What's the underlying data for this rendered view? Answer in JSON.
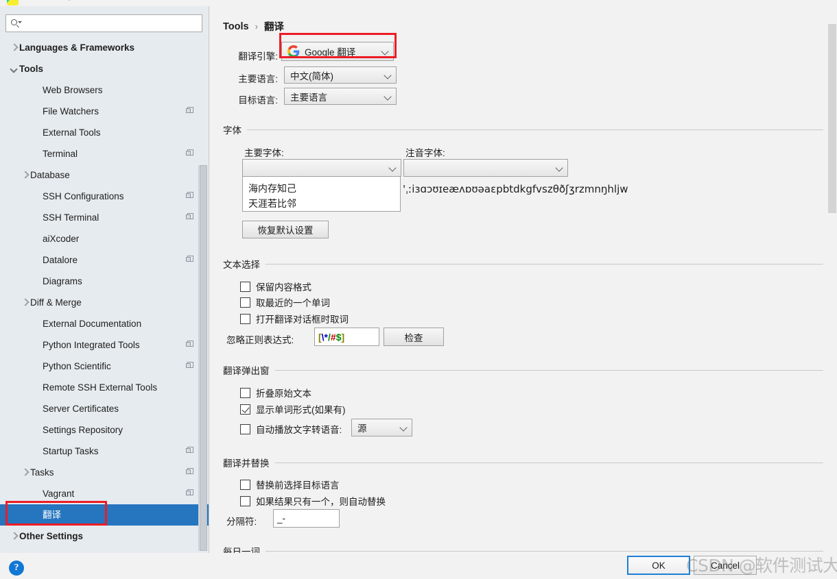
{
  "window": {
    "titlebar_icon": "pycharm-logo-icon"
  },
  "sidebar": {
    "search": {
      "value": "",
      "placeholder": ""
    },
    "items": [
      {
        "label": "Languages & Frameworks",
        "indent": 0,
        "arrow": "right",
        "bold": true,
        "copy": false,
        "selected": false
      },
      {
        "label": "Tools",
        "indent": 0,
        "arrow": "down",
        "bold": true,
        "copy": false,
        "selected": false
      },
      {
        "label": "Web Browsers",
        "indent": 2,
        "arrow": "none",
        "bold": false,
        "copy": false,
        "selected": false
      },
      {
        "label": "File Watchers",
        "indent": 2,
        "arrow": "none",
        "bold": false,
        "copy": true,
        "selected": false
      },
      {
        "label": "External Tools",
        "indent": 2,
        "arrow": "none",
        "bold": false,
        "copy": false,
        "selected": false
      },
      {
        "label": "Terminal",
        "indent": 2,
        "arrow": "none",
        "bold": false,
        "copy": true,
        "selected": false
      },
      {
        "label": "Database",
        "indent": 1,
        "arrow": "right",
        "bold": false,
        "copy": false,
        "selected": false
      },
      {
        "label": "SSH Configurations",
        "indent": 2,
        "arrow": "none",
        "bold": false,
        "copy": true,
        "selected": false
      },
      {
        "label": "SSH Terminal",
        "indent": 2,
        "arrow": "none",
        "bold": false,
        "copy": true,
        "selected": false
      },
      {
        "label": "aiXcoder",
        "indent": 2,
        "arrow": "none",
        "bold": false,
        "copy": false,
        "selected": false
      },
      {
        "label": "Datalore",
        "indent": 2,
        "arrow": "none",
        "bold": false,
        "copy": true,
        "selected": false
      },
      {
        "label": "Diagrams",
        "indent": 2,
        "arrow": "none",
        "bold": false,
        "copy": false,
        "selected": false
      },
      {
        "label": "Diff & Merge",
        "indent": 1,
        "arrow": "right",
        "bold": false,
        "copy": false,
        "selected": false
      },
      {
        "label": "External Documentation",
        "indent": 2,
        "arrow": "none",
        "bold": false,
        "copy": false,
        "selected": false
      },
      {
        "label": "Python Integrated Tools",
        "indent": 2,
        "arrow": "none",
        "bold": false,
        "copy": true,
        "selected": false
      },
      {
        "label": "Python Scientific",
        "indent": 2,
        "arrow": "none",
        "bold": false,
        "copy": true,
        "selected": false
      },
      {
        "label": "Remote SSH External Tools",
        "indent": 2,
        "arrow": "none",
        "bold": false,
        "copy": false,
        "selected": false
      },
      {
        "label": "Server Certificates",
        "indent": 2,
        "arrow": "none",
        "bold": false,
        "copy": false,
        "selected": false
      },
      {
        "label": "Settings Repository",
        "indent": 2,
        "arrow": "none",
        "bold": false,
        "copy": false,
        "selected": false
      },
      {
        "label": "Startup Tasks",
        "indent": 2,
        "arrow": "none",
        "bold": false,
        "copy": true,
        "selected": false
      },
      {
        "label": "Tasks",
        "indent": 1,
        "arrow": "right",
        "bold": false,
        "copy": true,
        "selected": false
      },
      {
        "label": "Vagrant",
        "indent": 2,
        "arrow": "none",
        "bold": false,
        "copy": true,
        "selected": false
      },
      {
        "label": "翻译",
        "indent": 2,
        "arrow": "none",
        "bold": false,
        "copy": false,
        "selected": true
      },
      {
        "label": "Other Settings",
        "indent": 0,
        "arrow": "right",
        "bold": true,
        "copy": false,
        "selected": false
      }
    ],
    "help_icon_label": "?"
  },
  "breadcrumb": {
    "root": "Tools",
    "separator": "›",
    "current": "翻译"
  },
  "engine_section": {
    "engine_label": "翻译引擎:",
    "engine_value": "Google 翻译",
    "engine_icon": "google-logo-icon",
    "primary_lang_label": "主要语言:",
    "primary_lang_value": "中文(简体)",
    "target_lang_label": "目标语言:",
    "target_lang_value": "主要语言"
  },
  "font_section": {
    "title": "字体",
    "primary_font_label": "主要字体:",
    "primary_font_value": "",
    "phonetic_font_label": "注音字体:",
    "phonetic_font_value": "",
    "preview_line1": "海内存知己",
    "preview_line2": "天涯若比邻",
    "phonetic_preview": "'ˌːiɜɑɔʊɪeæʌɒʊəaɛpbtdkgfvszθðʃʒrzmnŋhljw",
    "reset_button": "恢复默认设置"
  },
  "text_selection_section": {
    "title": "文本选择",
    "checkboxes": [
      {
        "label": "保留内容格式",
        "checked": false
      },
      {
        "label": "取最近的一个单词",
        "checked": false
      },
      {
        "label": "打开翻译对话框时取词",
        "checked": false
      }
    ],
    "regex_label": "忽略正则表达式:",
    "regex_value": "[\\*/#$]",
    "regex_tokens": [
      {
        "t": "[",
        "c": "rx-b"
      },
      {
        "t": "\\*",
        "c": "rx-blue"
      },
      {
        "t": "/",
        "c": "rx-green"
      },
      {
        "t": "#",
        "c": "rx-red"
      },
      {
        "t": "$",
        "c": "rx-green"
      },
      {
        "t": "]",
        "c": "rx-b"
      }
    ],
    "check_button": "检查"
  },
  "popup_section": {
    "title": "翻译弹出窗",
    "checkboxes": [
      {
        "label": "折叠原始文本",
        "checked": false
      },
      {
        "label": "显示单词形式(如果有)",
        "checked": true
      }
    ],
    "tts_label": "自动播放文字转语音:",
    "tts_checked": false,
    "tts_value": "源"
  },
  "replace_section": {
    "title": "翻译并替换",
    "checkboxes": [
      {
        "label": "替换前选择目标语言",
        "checked": false
      },
      {
        "label": "如果结果只有一个，则自动替换",
        "checked": false
      }
    ],
    "separator_label": "分隔符:",
    "separator_value": "_-"
  },
  "word_of_day_section": {
    "title": "每日一词"
  },
  "buttons": {
    "ok": "OK",
    "cancel": "Cancel"
  },
  "watermark": {
    "text": "CSDN @软件测试大空翼"
  },
  "colors": {
    "selection_blue": "#2675bf",
    "annotation_red": "#ec1c24",
    "ok_border_blue": "#1b7fd5",
    "help_blue": "#1077d5"
  }
}
